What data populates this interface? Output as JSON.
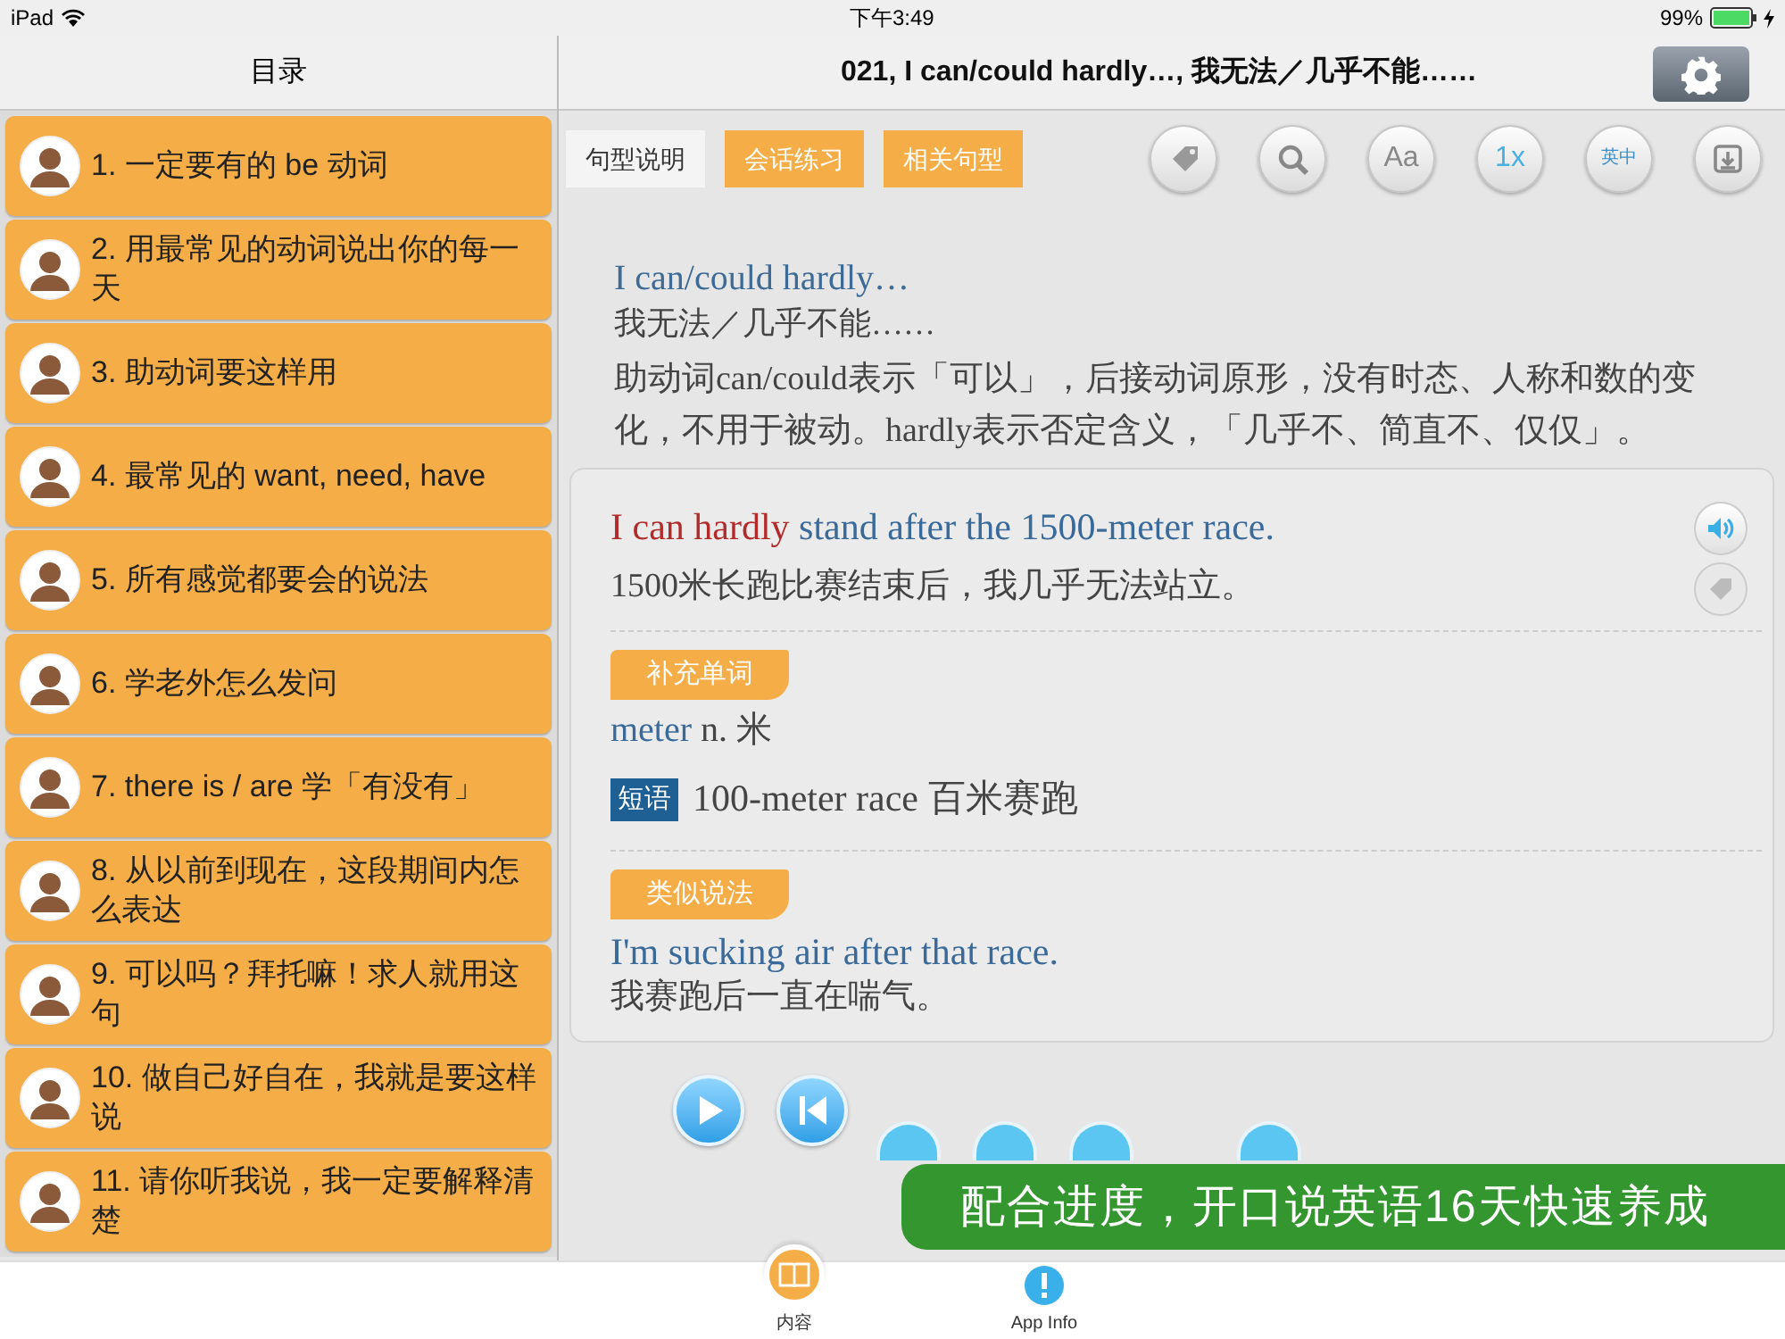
{
  "status_bar": {
    "device": "iPad",
    "time": "下午3:49",
    "battery": "99%"
  },
  "sidebar": {
    "title": "目录",
    "items": [
      {
        "label": "1. 一定要有的 be 动词"
      },
      {
        "label": "2. 用最常见的动词说出你的每一天"
      },
      {
        "label": "3. 助动词要这样用"
      },
      {
        "label": "4. 最常见的 want, need, have"
      },
      {
        "label": "5. 所有感觉都要会的说法"
      },
      {
        "label": "6. 学老外怎么发问"
      },
      {
        "label": "7. there is / are 学「有没有」"
      },
      {
        "label": "8. 从以前到现在，这段期间内怎么表达"
      },
      {
        "label": "9. 可以吗？拜托嘛！求人就用这句"
      },
      {
        "label": "10. 做自己好自在，我就是要这样说"
      },
      {
        "label": "11. 请你听我说，我一定要解释清楚"
      }
    ]
  },
  "title": "021, I can/could hardly…, 我无法／几乎不能……",
  "tabs": [
    {
      "label": "句型说明",
      "selected": true
    },
    {
      "label": "会话练习",
      "selected": false
    },
    {
      "label": "相关句型",
      "selected": false
    }
  ],
  "toolbar": [
    {
      "kind": "tag"
    },
    {
      "kind": "search"
    },
    {
      "kind": "font",
      "label": "Aa"
    },
    {
      "kind": "speed",
      "label": "1x"
    },
    {
      "kind": "lang",
      "label": "英中"
    },
    {
      "kind": "download"
    }
  ],
  "pattern": {
    "english": "I can/could hardly…",
    "chinese": "我无法／几乎不能……",
    "explanation": "助动词can/could表示「可以」，后接动词原形，没有时态、人称和数的变化，不用于被动。hardly表示否定含义，「几乎不、简直不、仅仅」。"
  },
  "example": {
    "sentence": [
      {
        "text": "I can hardly",
        "emphasis": true
      },
      {
        "text": " stand after the 1500-meter race.",
        "emphasis": false
      }
    ],
    "translation": "1500米长跑比赛结束后，我几乎无法站立。",
    "sections": [
      {
        "kind": "word",
        "heading": "补充单词",
        "word": "meter",
        "meaning": "n. 米"
      },
      {
        "kind": "phrase",
        "badge": "短语",
        "text": "100-meter race 百米赛跑"
      },
      {
        "kind": "similar",
        "heading": "类似说法",
        "english": "I'm sucking air after that race.",
        "chinese": "我赛跑后一直在喘气。"
      }
    ]
  },
  "banner": "配合进度，开口说英语16天快速养成",
  "tab_bar": [
    {
      "label": "内容",
      "kind": "book",
      "selected": true
    },
    {
      "label": "App Info",
      "kind": "info",
      "selected": false
    }
  ]
}
